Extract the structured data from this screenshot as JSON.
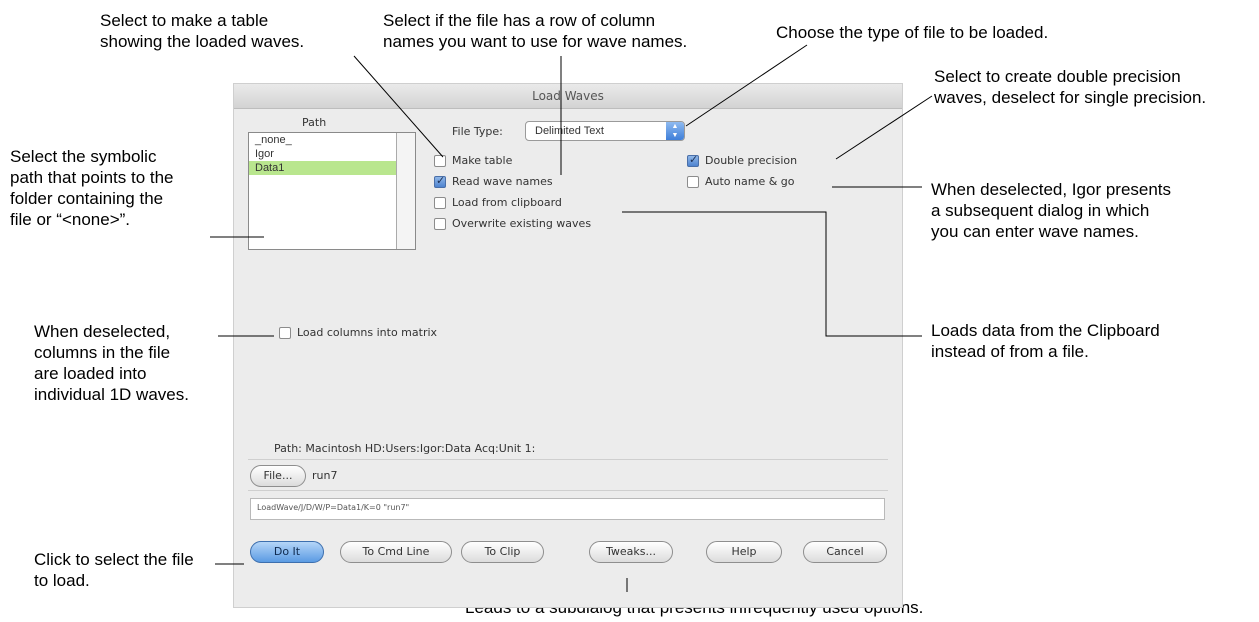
{
  "annotations": {
    "make_table": "Select to make a table\nshowing the loaded waves.",
    "read_names": "Select if the file has a row of column\nnames you want to use for wave names.",
    "file_type": "Choose the type of file to be loaded.",
    "double_precision": "Select to create double precision\nwaves, deselect for single precision.",
    "symbolic_path": "Select the symbolic\npath that points to the\nfolder containing the\nfile or “<none>”.",
    "auto_name": "When deselected, Igor presents\na subsequent dialog in which\nyou can enter wave names.",
    "load_matrix": "When deselected,\ncolumns in the file\nare loaded into\nindividual 1D waves.",
    "clipboard": "Loads data from the Clipboard\ninstead of from a file.",
    "do_it": "Click to select the file\nto load.",
    "tweaks": "Leads to a subdialog that presents infrequently used options."
  },
  "dialog": {
    "title": "Load Waves",
    "path_label": "Path",
    "path_items": [
      {
        "label": "_none_",
        "selected": false
      },
      {
        "label": "Igor",
        "selected": false
      },
      {
        "label": "Data1",
        "selected": true
      }
    ],
    "file_type_label": "File Type:",
    "file_type_value": "Delimited Text",
    "checkboxes": {
      "make_table": {
        "label": "Make table",
        "checked": false
      },
      "read_wave_names": {
        "label": "Read wave names",
        "checked": true
      },
      "load_from_clipboard": {
        "label": "Load from clipboard",
        "checked": false
      },
      "overwrite_existing": {
        "label": "Overwrite existing waves",
        "checked": false
      },
      "double_precision": {
        "label": "Double precision",
        "checked": true
      },
      "auto_name_go": {
        "label": "Auto name & go",
        "checked": false
      },
      "load_columns_matrix": {
        "label": "Load columns into matrix",
        "checked": false
      }
    },
    "path_line": "Path:  Macintosh HD:Users:Igor:Data Acq:Unit 1:",
    "file_button": "File...",
    "file_name": "run7",
    "command": "LoadWave/J/D/W/P=Data1/K=0 \"run7\"",
    "buttons": {
      "do_it": "Do It",
      "to_cmd_line": "To Cmd Line",
      "to_clip": "To Clip",
      "tweaks": "Tweaks...",
      "help": "Help",
      "cancel": "Cancel"
    }
  },
  "colors": {
    "selection": "#b9e68e",
    "default_button": "#5b9be3",
    "checkbox_checked": "#4e83cf"
  }
}
